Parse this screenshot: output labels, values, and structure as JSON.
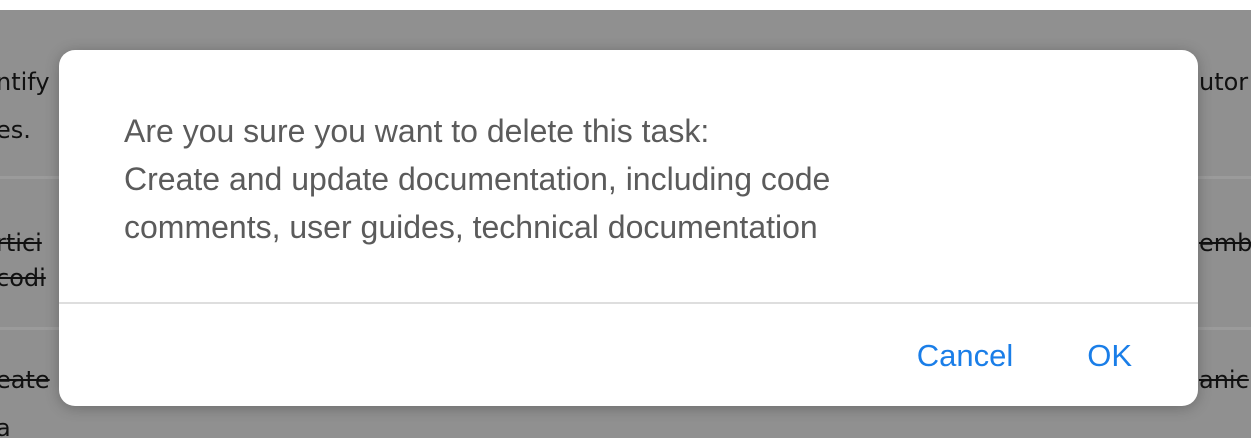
{
  "background": {
    "rows": [
      {
        "left_text": "ntify",
        "right_text": "utor",
        "strike": false
      },
      {
        "left_text": "es.",
        "right_text": "",
        "strike": false
      },
      {
        "left_text": "rtici",
        "right_text": "emb",
        "strike": true
      },
      {
        "left_text": "codi",
        "right_text": "",
        "strike": true
      },
      {
        "left_text": "eate",
        "right_text": "anic",
        "strike": true
      },
      {
        "left_text": "a",
        "right_text": "",
        "strike": false
      }
    ]
  },
  "dialog": {
    "message_lines": [
      "Are you sure you want to delete this task:",
      "Create and update documentation, including code",
      "comments, user guides, technical documentation"
    ],
    "cancel_label": "Cancel",
    "ok_label": "OK"
  },
  "colors": {
    "accent": "#1a7ee8",
    "message_text": "#5b5b5b",
    "overlay": "#8f8f8f",
    "dialog_bg": "#ffffff"
  }
}
